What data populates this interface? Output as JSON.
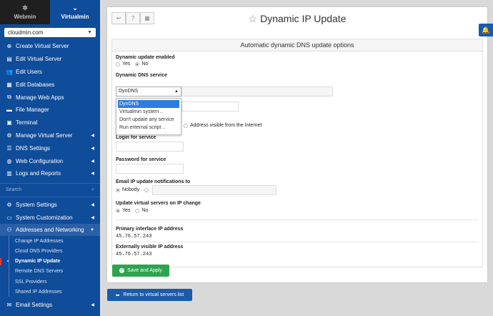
{
  "topbar": {
    "webmin_label": "Webmin",
    "virtualmin_label": "Virtualmin"
  },
  "domain": {
    "selected": "cloudmin.com"
  },
  "sidebar": {
    "items": [
      {
        "label": "Create Virtual Server",
        "icon": "plus-icon"
      },
      {
        "label": "Edit Virtual Server",
        "icon": "edit-icon"
      },
      {
        "label": "Edit Users",
        "icon": "users-icon"
      },
      {
        "label": "Edit Databases",
        "icon": "database-icon"
      },
      {
        "label": "Manage Web Apps",
        "icon": "apps-icon"
      },
      {
        "label": "File Manager",
        "icon": "folder-icon"
      },
      {
        "label": "Terminal",
        "icon": "terminal-icon"
      },
      {
        "label": "Manage Virtual Server",
        "icon": "server-icon"
      },
      {
        "label": "DNS Settings",
        "icon": "dns-icon"
      },
      {
        "label": "Web Configuration",
        "icon": "globe-icon"
      },
      {
        "label": "Logs and Reports",
        "icon": "chart-icon"
      }
    ],
    "search_placeholder": "Search",
    "items2": [
      {
        "label": "System Settings",
        "icon": "gear-icon"
      },
      {
        "label": "System Customization",
        "icon": "sliders-icon"
      },
      {
        "label": "Addresses and Networking",
        "icon": "network-icon"
      }
    ],
    "sub_items": [
      "Change IP Addresses",
      "Cloud DNS Providers",
      "Dynamic IP Update",
      "Remote DNS Servers",
      "SSL Providers",
      "Shared IP Addresses"
    ],
    "email_settings": "Email Settings"
  },
  "page": {
    "title": "Dynamic IP Update",
    "panel_title": "Automatic dynamic DNS update options",
    "dyn_enabled_label": "Dynamic update enabled",
    "yes": "Yes",
    "no": "No",
    "service_label": "Dynamic DNS service",
    "service_selected": "DynDNS",
    "service_options": [
      "DynDNS",
      "Virtualmin system ..",
      "Don't update any service",
      "Run external script .."
    ],
    "address_visible": "Address visible from the Internet",
    "login_label": "Login for service",
    "password_label": "Password for service",
    "email_label": "Email IP update notifications to",
    "nobody": "Nobody",
    "update_servers_label": "Update virtual servers on IP change",
    "primary_ip_label": "Primary interface IP address",
    "primary_ip": "45.76.57.243",
    "external_ip_label": "Externally visible IP address",
    "external_ip": "45.76.57.243",
    "save_button": "Save and Apply",
    "back_button": "Return to virtual servers list"
  }
}
